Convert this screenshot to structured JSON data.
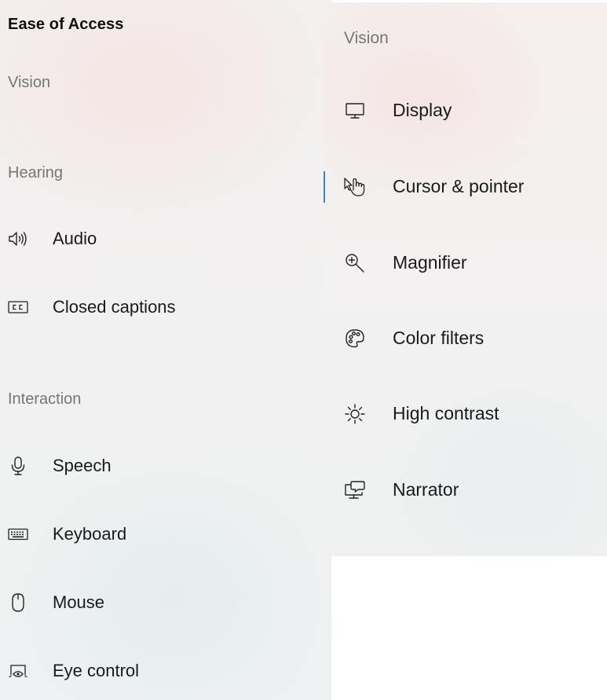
{
  "left_pane": {
    "title": "Ease of Access",
    "sections": {
      "vision": "Vision",
      "hearing": "Hearing",
      "interaction": "Interaction"
    },
    "items": [
      {
        "label": "Audio",
        "icon": "speaker-icon"
      },
      {
        "label": "Closed captions",
        "icon": "closed-captions-icon"
      },
      {
        "label": "Speech",
        "icon": "microphone-icon"
      },
      {
        "label": "Keyboard",
        "icon": "keyboard-icon"
      },
      {
        "label": "Mouse",
        "icon": "mouse-icon"
      },
      {
        "label": "Eye control",
        "icon": "eye-control-icon"
      }
    ]
  },
  "flyout": {
    "header": "Vision",
    "selected": "Cursor & pointer",
    "items": [
      {
        "label": "Display",
        "icon": "monitor-icon"
      },
      {
        "label": "Cursor & pointer",
        "icon": "hand-pointer-icon"
      },
      {
        "label": "Magnifier",
        "icon": "magnifier-icon"
      },
      {
        "label": "Color filters",
        "icon": "palette-icon"
      },
      {
        "label": "High contrast",
        "icon": "sun-icon"
      },
      {
        "label": "Narrator",
        "icon": "narrator-icon"
      }
    ]
  },
  "colors": {
    "accent": "#4a7fb0",
    "text": "#1a1a1a",
    "header_text": "#767676"
  }
}
